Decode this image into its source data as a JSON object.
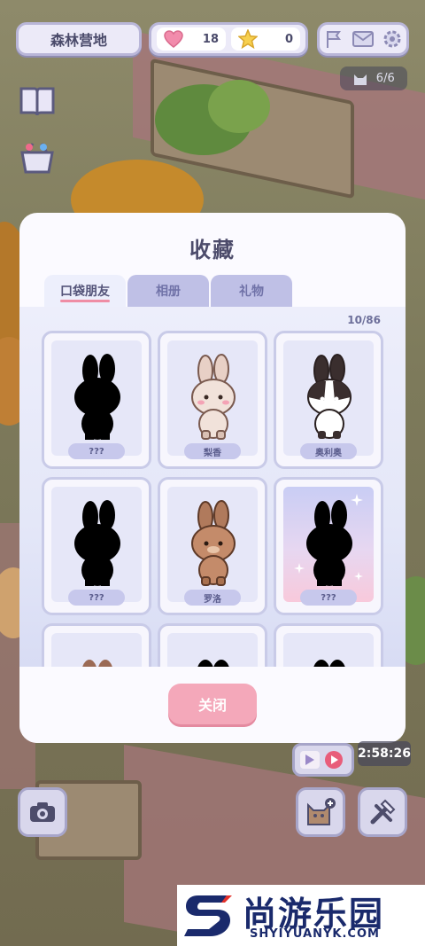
{
  "hud": {
    "location": "森林营地",
    "hearts": "18",
    "stars": "0",
    "capacity": "6/6"
  },
  "modal": {
    "title": "收藏",
    "tabs": [
      "口袋朋友",
      "相册",
      "礼物"
    ],
    "active_tab": "口袋朋友",
    "collected_count": "10/86",
    "cards": [
      {
        "name": "???",
        "discovered": false
      },
      {
        "name": "梨香",
        "discovered": true
      },
      {
        "name": "奥利奥",
        "discovered": true
      },
      {
        "name": "???",
        "discovered": false
      },
      {
        "name": "罗洛",
        "discovered": true
      },
      {
        "name": "???",
        "discovered": false,
        "special": true
      }
    ],
    "close_label": "关闭"
  },
  "timer": "2:58:26",
  "watermark": {
    "title": "尚游乐园",
    "url": "SHYIYUANYK.COM"
  },
  "colors": {
    "accent_pink": "#f4a8ba",
    "tab_active": "#edeffc",
    "tab_inactive": "#bfc0e6",
    "text_dark": "#4d4c6b"
  }
}
